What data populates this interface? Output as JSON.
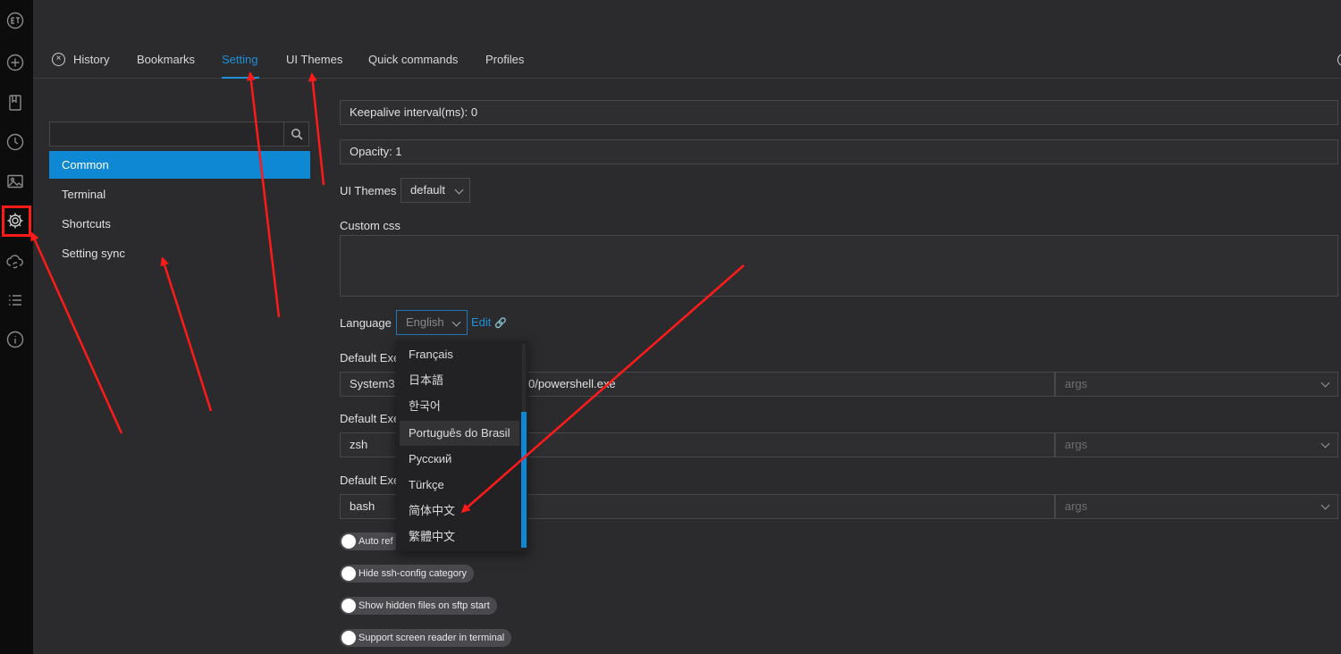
{
  "tabs": {
    "history": "History",
    "bookmarks": "Bookmarks",
    "setting": "Setting",
    "ui_themes": "UI Themes",
    "quick_commands": "Quick commands",
    "profiles": "Profiles"
  },
  "sidebar": {
    "search_placeholder": "",
    "items": [
      "Common",
      "Terminal",
      "Shortcuts",
      "Setting sync"
    ]
  },
  "common": {
    "keepalive": "Keepalive interval(ms): 0",
    "opacity": "Opacity: 1",
    "ui_themes_label": "UI Themes",
    "ui_themes_value": "default",
    "custom_css_label": "Custom css",
    "language_label": "Language",
    "language_value": "English",
    "edit_link": "Edit",
    "default_exec_1_label": "Default Exe",
    "default_exec_1_value_start": "System3",
    "default_exec_1_value_end": "0/powershell.exe",
    "default_exec_2_label": "Default Exe",
    "default_exec_2_value": "zsh",
    "default_exec_3_label": "Default Exe",
    "default_exec_3_value": "bash",
    "args_placeholder": "args",
    "toggle_auto": "Auto ref",
    "toggle_hide_ssh": "Hide ssh-config category",
    "toggle_hidden_files": "Show hidden files on sftp start",
    "toggle_screen_reader": "Support screen reader in terminal"
  },
  "language_options": [
    "Français",
    "日本語",
    "한국어",
    "Português do Brasil",
    "Русский",
    "Türkçe",
    "简体中文",
    "繁體中文"
  ],
  "language_hover_index": 3,
  "colors": {
    "accent": "#0e88d3",
    "annotation": "#ff1a1a",
    "background": "#2b2b2e",
    "rail": "#0c0c0c"
  },
  "rail_icons": [
    "logo-icon",
    "plus-icon",
    "bookmark-icon",
    "clock-icon",
    "image-icon",
    "gear-icon",
    "cloud-sync-icon",
    "list-icon",
    "info-icon"
  ]
}
